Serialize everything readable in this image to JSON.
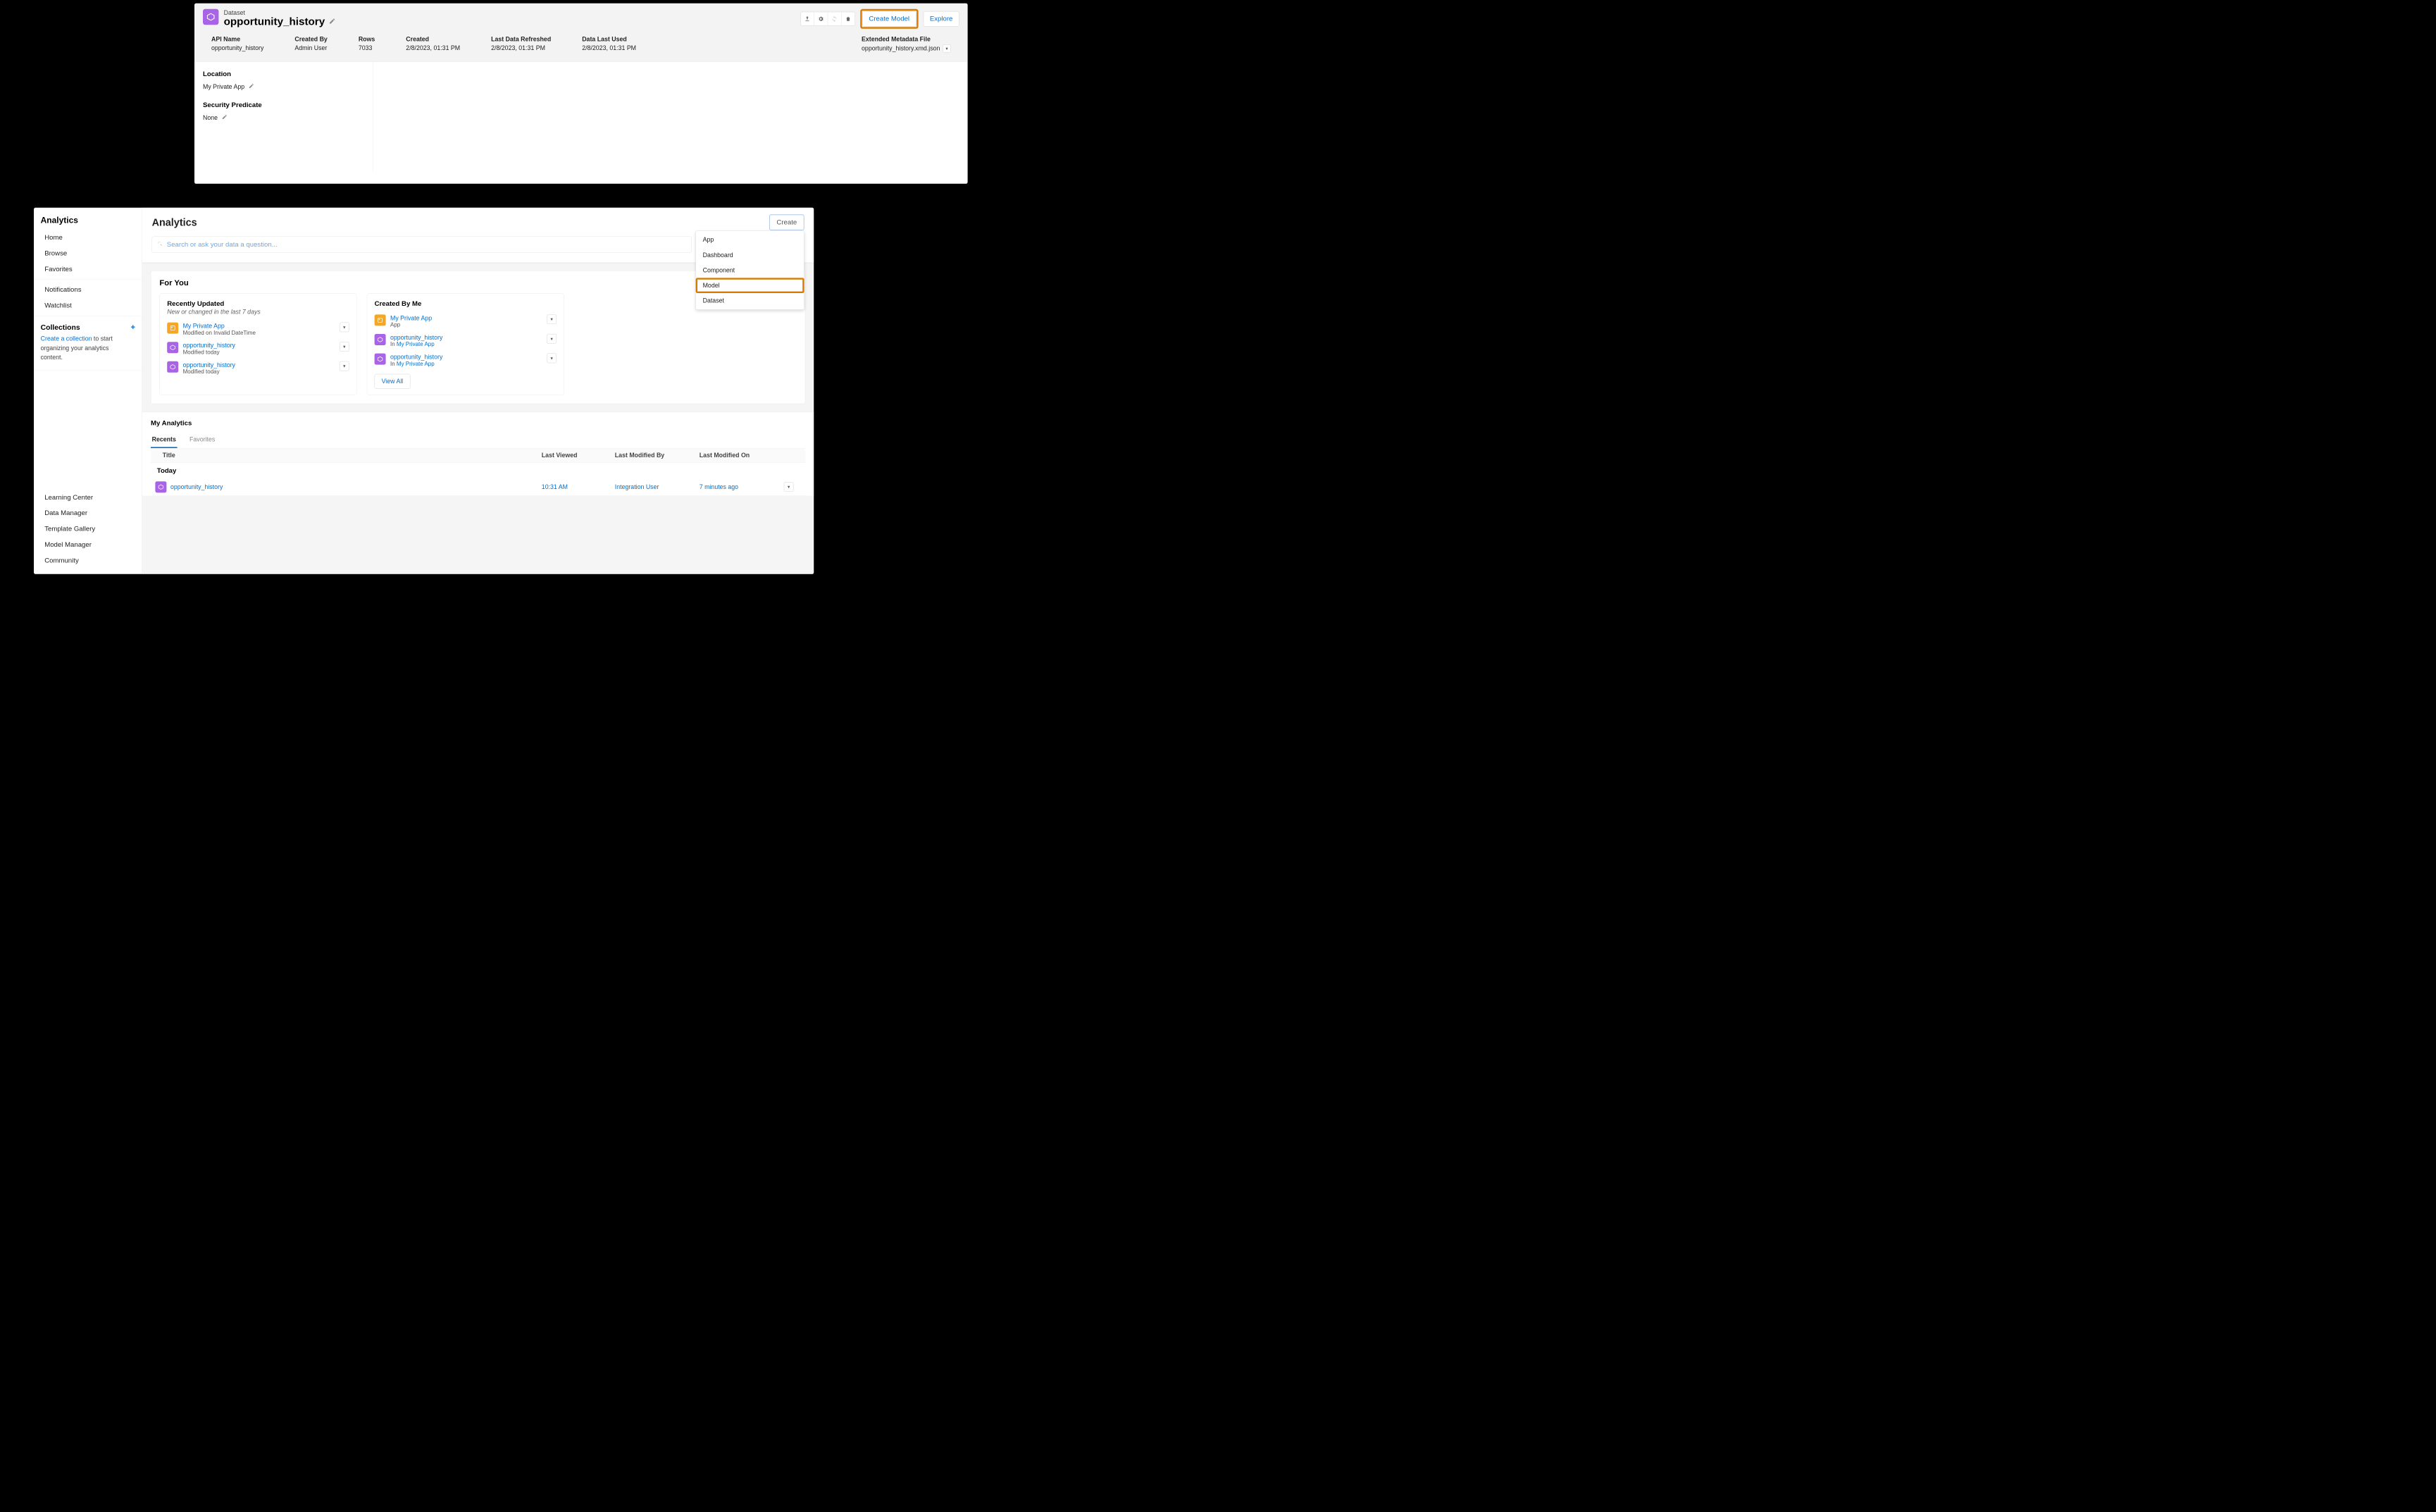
{
  "top": {
    "type_label": "Dataset",
    "title": "opportunity_history",
    "actions": {
      "create_model": "Create Model",
      "explore": "Explore"
    },
    "meta": {
      "api_name": {
        "label": "API Name",
        "value": "opportunity_history"
      },
      "created_by": {
        "label": "Created By",
        "value": "Admin User"
      },
      "rows": {
        "label": "Rows",
        "value": "7033"
      },
      "created": {
        "label": "Created",
        "value": "2/8/2023, 01:31 PM"
      },
      "refreshed": {
        "label": "Last Data Refreshed",
        "value": "2/8/2023, 01:31 PM"
      },
      "last_used": {
        "label": "Data Last Used",
        "value": "2/8/2023, 01:31 PM"
      },
      "xmd": {
        "label": "Extended Metadata File",
        "value": "opportunity_history.xmd.json"
      }
    },
    "body": {
      "location_label": "Location",
      "location_value": "My Private App",
      "predicate_label": "Security Predicate",
      "predicate_value": "None"
    }
  },
  "bottom": {
    "sidebar": {
      "heading": "Analytics",
      "items_top": [
        "Home",
        "Browse",
        "Favorites"
      ],
      "items_mid": [
        "Notifications",
        "Watchlist"
      ],
      "collections_h": "Collections",
      "collections_link": "Create a collection",
      "collections_desc_rest": " to start organizing your analytics content.",
      "items_bottom": [
        "Learning Center",
        "Data Manager",
        "Template Gallery",
        "Model Manager",
        "Community"
      ]
    },
    "main": {
      "heading": "Analytics",
      "create_button": "Create",
      "search_placeholder": "Search or ask your data a question...",
      "create_menu": [
        "App",
        "Dashboard",
        "Component",
        "Model",
        "Dataset"
      ],
      "create_menu_highlight_index": 3,
      "for_you_h": "For You",
      "recent": {
        "h": "Recently Updated",
        "sub": "New or changed in the last 7 days",
        "items": [
          {
            "icon": "app",
            "title": "My Private App",
            "sub": "Modified on Invalid DateTime"
          },
          {
            "icon": "dataset",
            "title": "opportunity_history",
            "sub": "Modified today"
          },
          {
            "icon": "dataset",
            "title": "opportunity_history",
            "sub": "Modified today"
          }
        ]
      },
      "created": {
        "h": "Created By Me",
        "items": [
          {
            "icon": "app",
            "title": "My Private App",
            "sub_plain": "App"
          },
          {
            "icon": "dataset",
            "title": "opportunity_history",
            "sub_prefix": "In ",
            "sub_link": "My Private App"
          },
          {
            "icon": "dataset",
            "title": "opportunity_history",
            "sub_prefix": "In ",
            "sub_link": "My Private App"
          }
        ],
        "view_all": "View All"
      },
      "my_analytics_h": "My Analytics",
      "tabs": {
        "recents": "Recents",
        "favorites": "Favorites"
      },
      "table_head": {
        "title": "Title",
        "lv": "Last Viewed",
        "lmb": "Last Modified By",
        "lmo": "Last Modified On"
      },
      "date_group": "Today",
      "row": {
        "title": "opportunity_history",
        "lv": "10:31 AM",
        "lmb": "Integration User",
        "lmo": "7 minutes ago"
      }
    }
  }
}
